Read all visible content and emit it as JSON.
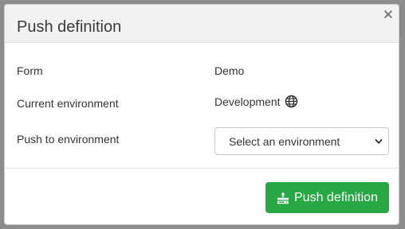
{
  "dialog": {
    "title": "Push definition",
    "close_icon": "close-icon"
  },
  "rows": {
    "form_label": "Form",
    "form_value": "Demo",
    "current_env_label": "Current environment",
    "current_env_value": "Development",
    "current_env_icon": "globe-icon",
    "push_env_label": "Push to environment"
  },
  "select": {
    "selected": "Select an environment",
    "icon": "chevron-down-icon"
  },
  "footer": {
    "push_button_label": "Push definition",
    "push_button_icon": "push-icon",
    "push_button_color": "#28a745"
  }
}
